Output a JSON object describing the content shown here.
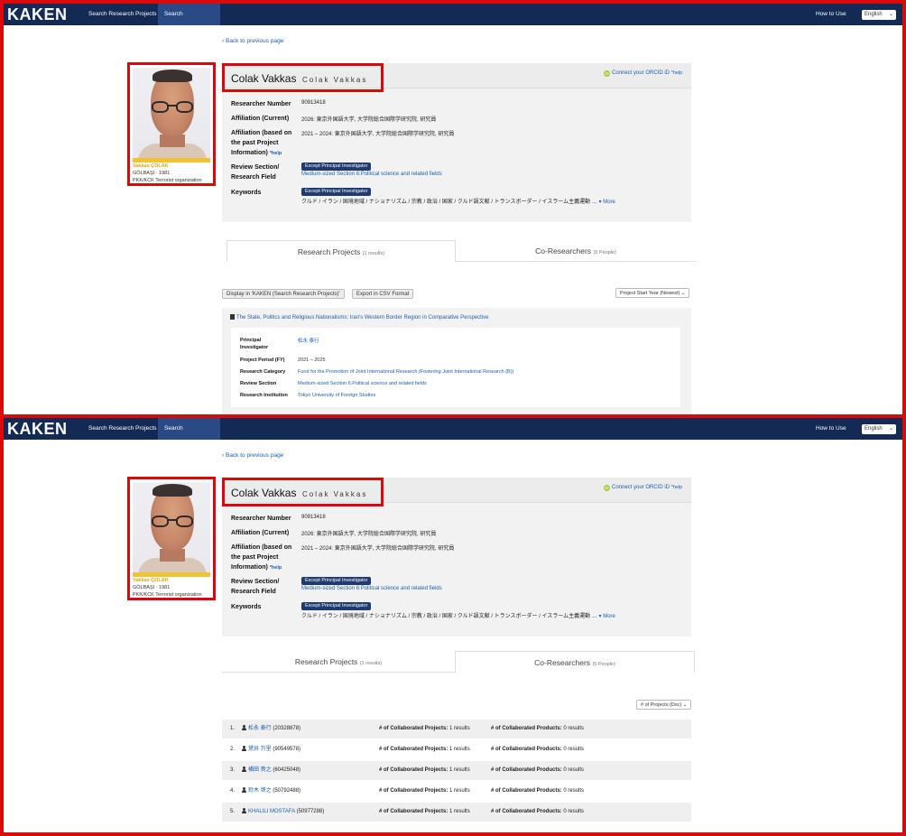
{
  "nav": {
    "logo": "KAKEN",
    "search_projects": "Search Research Projects",
    "search_researchers": "Search Researchers",
    "how_to_use": "How to Use",
    "language": "English"
  },
  "back_link": "Back to previous page",
  "photo_caption": {
    "name": "Vakkas ÇOLAK",
    "line2": "GÖLBAŞI · 1981",
    "line3": "PKK/KCK Terrorist organization"
  },
  "researcher": {
    "name": "Colak Vakkas",
    "kana": "Colak Vakkas",
    "orcid_link": "Connect your ORCID iD",
    "help": "*help",
    "number_label": "Researcher Number",
    "number": "90913418",
    "affil_current_label": "Affiliation (Current)",
    "affil_current": "2026: 東京外国語大学, 大学院総合国際学研究院, 研究員",
    "affil_past_label_1": "Affiliation (based on",
    "affil_past_label_2": "the past Project",
    "affil_past_label_3": "Information)",
    "affil_past": "2021 – 2024: 東京外国語大学, 大学院総合国際学研究院, 研究員",
    "review_label_1": "Review Section/",
    "review_label_2": "Research Field",
    "review_badge": "Except Principal Investigator",
    "review_value": "Medium-sized Section 6:Political science and related fields",
    "keywords_label": "Keywords",
    "keywords_badge": "Except Principal Investigator",
    "keywords_value": "クルド / イラン / 国境地域 / ナショナリズム / 宗教 / 政治 / 国家 / クルド語文献 / トランスボーダー / イスラーム主義運動 …",
    "more": "▾ More"
  },
  "tabs": {
    "projects_label": "Research Projects",
    "projects_count": "(1 results)",
    "co_label": "Co-Researchers",
    "co_count": "(5 People)"
  },
  "panel1": {
    "display_btn": "Display in 'KAKEN (Search Research Projects)'",
    "csv_btn": "Export in CSV Format",
    "sort": "Project Start Year (Newest)",
    "project": {
      "title": "The State, Politics and Religious Nationalisms: Iran's Western Border Region in Comparative Perspective",
      "pi_label_1": "Principal",
      "pi_label_2": "Investigator",
      "pi": "松永 泰行",
      "period_label": "Project Period (FY)",
      "period": "2021 – 2025",
      "category_label": "Research Category",
      "category": "Fund for the Promotion of Joint International Research (Fostering Joint International Research (B))",
      "review_label": "Review Section",
      "review": "Medium-sized Section 6:Political science and related fields",
      "institution_label": "Research Institution",
      "institution": "Tokyo University of Foreign Studies"
    }
  },
  "panel2": {
    "sort": "# of Projects (Dsc)",
    "collab_projects_label": "# of Collaborated Projects:",
    "collab_products_label": "# of Collaborated Products:",
    "co_researchers": [
      {
        "num": "1.",
        "name": "松永 泰行",
        "id": "(20328878)",
        "projects": "1 results",
        "products": "0 results"
      },
      {
        "num": "2.",
        "name": "黛井 万里",
        "id": "(90549578)",
        "projects": "1 results",
        "products": "0 results"
      },
      {
        "num": "3.",
        "name": "横田 貴之",
        "id": "(60425048)",
        "projects": "1 results",
        "products": "0 results"
      },
      {
        "num": "4.",
        "name": "鈴木 啓之",
        "id": "(50792488)",
        "projects": "1 results",
        "products": "0 results"
      },
      {
        "num": "5.",
        "name": "KHALILI MOSTAFA",
        "id": "(50977288)",
        "projects": "1 results",
        "products": "0 results"
      }
    ]
  }
}
